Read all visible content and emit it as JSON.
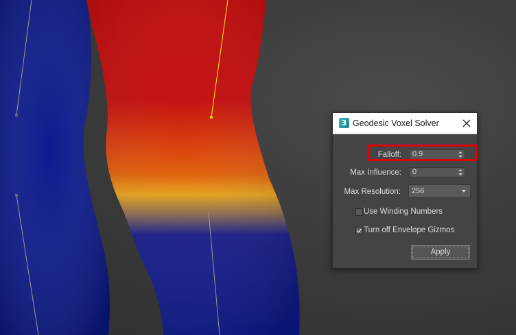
{
  "colors": {
    "background": "#3a3a3a",
    "mesh_blue": "#0b1a8c",
    "mesh_red": "#c80a0a",
    "mesh_orange": "#e0600a",
    "mesh_yellow": "#e6a21c",
    "dialog_bg": "#444444",
    "highlight": "#e00000"
  },
  "dialog": {
    "title": "Geodesic Voxel Solver",
    "app_icon": "3",
    "close_icon": "close-icon",
    "falloff": {
      "label": "Falloff:",
      "value": "0.9"
    },
    "max_influence": {
      "label": "Max Influence:",
      "value": "0"
    },
    "max_resolution": {
      "label": "Max Resolution:",
      "value": "256"
    },
    "use_winding_numbers": {
      "label": "Use Winding Numbers",
      "checked": false
    },
    "turn_off_envelope_gizmos": {
      "label": "Turn off Envelope Gizmos",
      "checked": true
    },
    "apply_label": "Apply"
  }
}
